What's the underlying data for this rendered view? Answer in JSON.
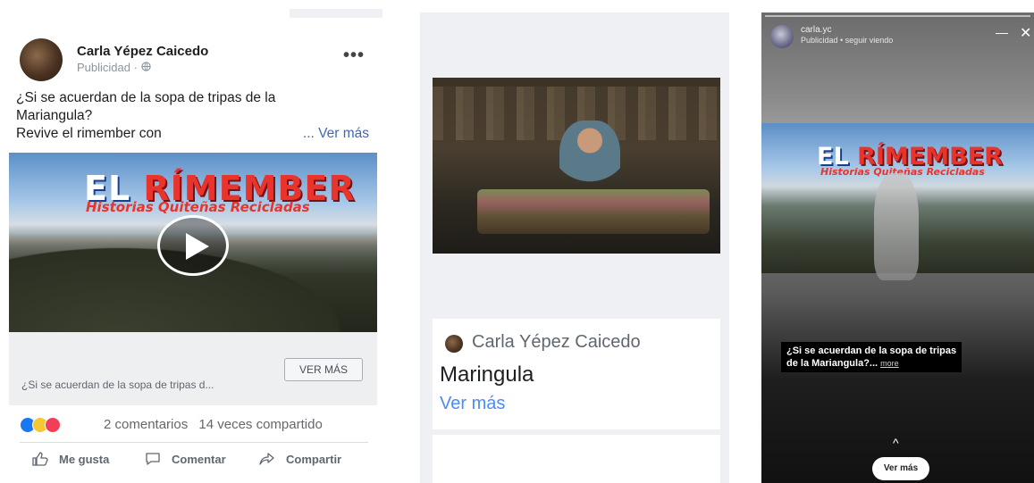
{
  "feed_post": {
    "author": "Carla Yépez Caicedo",
    "sponsored_label": "Publicidad · ",
    "globe_icon": "globe-icon",
    "more_label": "•••",
    "text_line1": "¿Si se acuerdan de la sopa de tripas de la",
    "text_line2": "Mariangula?",
    "text_line3": "Revive el rimember con",
    "see_more_link": "... Ver más",
    "video": {
      "title_part1": "EL ",
      "title_part2": "RÍMEMBER",
      "subtitle": "Historias Quiteñas Recicladas",
      "play_icon": "play-icon"
    },
    "cta": {
      "description": "¿Si se acuerdan de la sopa de tripas d...",
      "button_label": "VER MÁS"
    },
    "reactions": [
      "like-icon",
      "haha-icon",
      "love-icon"
    ],
    "comments": "2 comentarios",
    "shares": "14 veces compartido",
    "actions": {
      "like": "Me gusta",
      "comment": "Comentar",
      "share": "Compartir"
    }
  },
  "instream_ad": {
    "author": "Carla Yépez Caicedo",
    "title": "Maringula",
    "see_more": "Ver más"
  },
  "story_ad": {
    "account": "carla.yc",
    "sub": "Publicidad  •  seguir viendo",
    "minimize": "—",
    "close": "✕",
    "banner_title_part1": "EL ",
    "banner_title_part2": "RÍMEMBER",
    "banner_subtitle": "Historias Quiteñas Recicladas",
    "caption_line1": "¿Si se acuerdan de la sopa de tripas",
    "caption_line2": "de la Mariangula?...",
    "caption_more": "more",
    "swipe_icon": "^",
    "button_label": "Ver más"
  },
  "colors": {
    "fb_blue": "#4267b2",
    "link_blue": "#4c8bf5",
    "accent_red": "#e8342c"
  }
}
